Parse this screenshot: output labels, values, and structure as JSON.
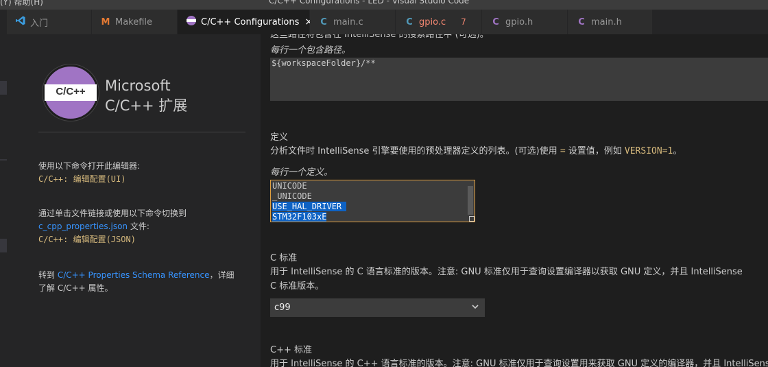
{
  "titlebar": {
    "left": "(Y)   帮助(H)",
    "center": "C/C++ Configurations - LED - Visual Studio Code"
  },
  "tabs": [
    {
      "label": "入门",
      "icon": "vscode-icon",
      "color": "#3b9de0"
    },
    {
      "label": "Makefile",
      "icon": "makefile-icon",
      "color": "#e37933"
    },
    {
      "label": "C/C++ Configurations",
      "icon": "cpp-extension-icon",
      "active": true,
      "close": "×"
    },
    {
      "label": "main.c",
      "icon": "c-file-icon",
      "glyph": "C",
      "color": "#519aba"
    },
    {
      "label": "gpio.c",
      "icon": "c-file-icon",
      "glyph": "C",
      "color": "#519aba",
      "labelColor": "#f48771",
      "count": "7"
    },
    {
      "label": "gpio.h",
      "icon": "h-file-icon",
      "glyph": "C",
      "color": "#a074c4"
    },
    {
      "label": "main.h",
      "icon": "h-file-icon",
      "glyph": "C",
      "color": "#a074c4"
    }
  ],
  "side": {
    "logo_text": "C/C++",
    "brand_line1": "Microsoft",
    "brand_line2": "C/C++ 扩展",
    "open_ui_text": "使用以下命令打开此编辑器:",
    "open_ui_cmd": "C/C++: 编辑配置(UI)",
    "switch_text_1": "通过单击文件链接或使用以下命令切换到",
    "switch_link": "c_cpp_properties.json",
    "switch_text_2": " 文件:",
    "switch_cmd": "C/C++: 编辑配置(JSON)",
    "ref_prefix": "转到 ",
    "ref_link": "C/C++ Properties Schema Reference",
    "ref_suffix": "，详细",
    "ref_line2": "了解 C/C++ 属性。"
  },
  "main": {
    "cut_top": "这些路径将包含在 IntelliSense 的搜索路径中 (可选)。",
    "include_hint": "每行一个包含路径。",
    "include_value": "${workspaceFolder}/**",
    "defines_title": "定义",
    "defines_desc_1": "分析文件时 IntelliSense 引擎要使用的预处理器定义的列表。(可选)使用 ",
    "defines_desc_eq": "=",
    "defines_desc_2": " 设置值，例如 ",
    "defines_desc_code": "VERSION=1",
    "defines_desc_3": "。",
    "defines_hint": "每行一个定义。",
    "defines": [
      "UNICODE",
      "_UNICODE",
      "USE_HAL_DRIVER ",
      "STM32F103xE"
    ],
    "cstd_title": "C 标准",
    "cstd_desc_1": "用于 IntelliSense 的 C 语言标准的版本。注意: GNU 标准仅用于查询设置编译器以获取 GNU 定义，并且 IntelliSense",
    "cstd_desc_2": "C 标准版本。",
    "cstd_value": "c99",
    "cppstd_title": "C++ 标准",
    "cppstd_desc": "用于 IntelliSense 的 C++ 语言标准的版本。注意: GNU 标准仅用于查询设置用来获取 GNU 定义的编译器，并且 IntelliSense"
  }
}
